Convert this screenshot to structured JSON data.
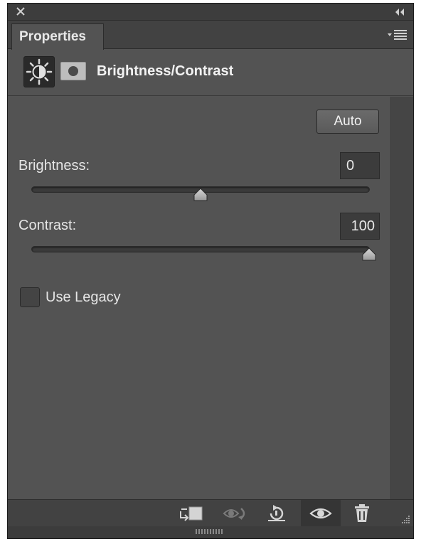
{
  "panel": {
    "tab_label": "Properties",
    "header_title": "Brightness/Contrast"
  },
  "controls": {
    "auto_label": "Auto",
    "brightness": {
      "label": "Brightness:",
      "value": "0",
      "level": 0.5
    },
    "contrast": {
      "label": "Contrast:",
      "value": "100",
      "level": 1.0
    },
    "legacy": {
      "label": "Use Legacy",
      "checked": false
    }
  },
  "icons": {
    "close": "close-icon",
    "collapse": "double-chevron-left-icon",
    "panel_menu": "panel-menu-icon",
    "adjustment": "brightness-sun-icon",
    "mask": "layer-mask-icon",
    "clip": "clip-to-layer-icon",
    "view_previous": "view-previous-state-icon",
    "reset": "reset-adjustment-icon",
    "visibility": "eye-icon",
    "delete": "trash-icon"
  }
}
